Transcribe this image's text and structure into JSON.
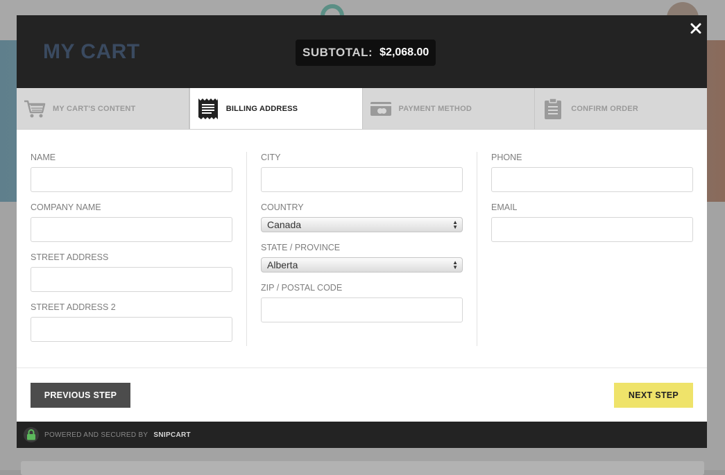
{
  "header": {
    "title": "MY CART",
    "subtotal_label": "SUBTOTAL:",
    "subtotal_value": "$2,068.00",
    "close_icon": "close-icon"
  },
  "steps": [
    {
      "label": "MY CART'S CONTENT",
      "icon": "cart-icon",
      "active": false
    },
    {
      "label": "BILLING ADDRESS",
      "icon": "receipt-icon",
      "active": true
    },
    {
      "label": "PAYMENT METHOD",
      "icon": "credit-card-icon",
      "active": false
    },
    {
      "label": "CONFIRM ORDER",
      "icon": "clipboard-icon",
      "active": false
    }
  ],
  "form": {
    "name_label": "NAME",
    "name_value": "",
    "company_label": "COMPANY NAME",
    "company_value": "",
    "street_label": "STREET ADDRESS",
    "street_value": "",
    "street2_label": "STREET ADDRESS 2",
    "street2_value": "",
    "city_label": "CITY",
    "city_value": "",
    "country_label": "COUNTRY",
    "country_value": "Canada",
    "state_label": "STATE / PROVINCE",
    "state_value": "Alberta",
    "zip_label": "ZIP / POSTAL CODE",
    "zip_value": "",
    "phone_label": "PHONE",
    "phone_value": "",
    "email_label": "EMAIL",
    "email_value": ""
  },
  "actions": {
    "previous_label": "PREVIOUS STEP",
    "next_label": "NEXT STEP"
  },
  "footer": {
    "text": "POWERED AND SECURED BY",
    "brand": "SNIPCART",
    "icon": "lock-icon"
  },
  "colors": {
    "header_bg": "#232323",
    "title": "#3a4a60",
    "next_button": "#efe36a",
    "previous_button": "#4c4c4c",
    "lock_green": "#5cb85c"
  }
}
